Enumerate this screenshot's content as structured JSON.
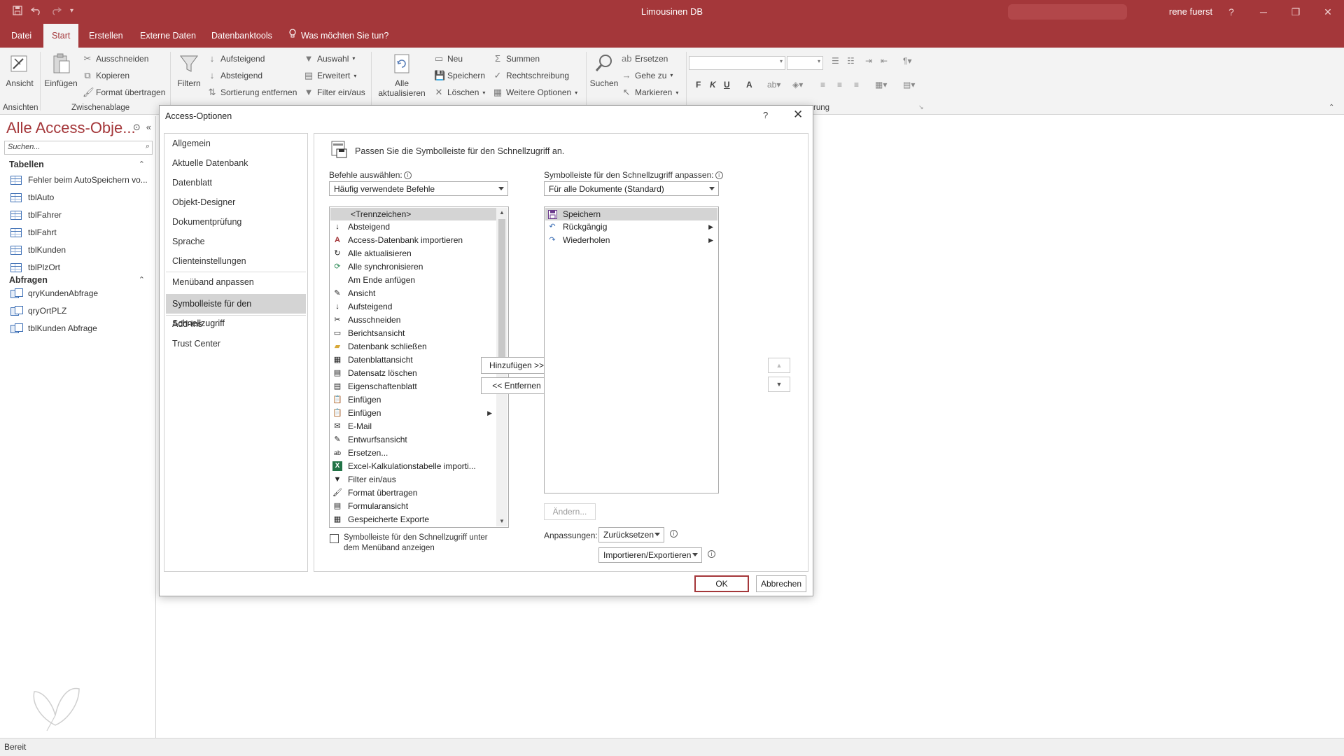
{
  "app": {
    "title": "Limousinen DB",
    "user": "rene fuerst"
  },
  "tabs": [
    "Datei",
    "Start",
    "Erstellen",
    "Externe Daten",
    "Datenbanktools"
  ],
  "tell_me": "Was möchten Sie tun?",
  "ribbon": {
    "ansicht": "Ansicht",
    "einfuegen": "Einfügen",
    "ausschneiden": "Ausschneiden",
    "kopieren": "Kopieren",
    "format_uebertragen": "Format übertragen",
    "filtern": "Filtern",
    "aufsteigend": "Aufsteigend",
    "absteigend": "Absteigend",
    "sortierung_entfernen": "Sortierung entfernen",
    "auswahl": "Auswahl",
    "erweitert": "Erweitert",
    "filter_ein_aus": "Filter ein/aus",
    "alle_aktualisieren_1": "Alle",
    "alle_aktualisieren_2": "aktualisieren",
    "neu": "Neu",
    "speichern": "Speichern",
    "loeschen": "Löschen",
    "summen": "Summen",
    "rechtschreibung": "Rechtschreibung",
    "weitere_optionen": "Weitere Optionen",
    "suchen": "Suchen",
    "ersetzen": "Ersetzen",
    "gehe_zu": "Gehe zu",
    "markieren": "Markieren",
    "fmt_bold": "F",
    "fmt_italic": "K",
    "fmt_underline": "U",
    "fmt_fontcolor": "A",
    "group_ansichten": "Ansichten",
    "group_zwischenablage": "Zwischenablage",
    "group_partial": "rung"
  },
  "nav": {
    "header": "Alle Access-Obje...",
    "search_placeholder": "Suchen...",
    "groups": [
      {
        "label": "Tabellen",
        "items": [
          "Fehler beim AutoSpeichern vo...",
          "tblAuto",
          "tblFahrer",
          "tblFahrt",
          "tblKunden",
          "tblPlzOrt"
        ]
      },
      {
        "label": "Abfragen",
        "items": [
          "qryKundenAbfrage",
          "qryOrtPLZ",
          "tblKunden Abfrage"
        ]
      }
    ]
  },
  "status": "Bereit",
  "dialog": {
    "title": "Access-Optionen",
    "help": "?",
    "close": "✕",
    "categories": [
      "Allgemein",
      "Aktuelle Datenbank",
      "Datenblatt",
      "Objekt-Designer",
      "Dokumentprüfung",
      "Sprache",
      "Clienteinstellungen",
      "Menüband anpassen",
      "Symbolleiste für den Schnellzugriff",
      "Add-Ins",
      "Trust Center"
    ],
    "selected_category": "Symbolleiste für den Schnellzugriff",
    "heading": "Passen Sie die Symbolleiste für den Schnellzugriff an.",
    "commands_label": "Befehle auswählen:",
    "commands_value": "Häufig verwendete Befehle",
    "toolbar_label": "Symbolleiste für den Schnellzugriff anpassen:",
    "toolbar_value": "Für alle Dokumente (Standard)",
    "commands": [
      {
        "label": "<Trennzeichen>",
        "icon": "separator"
      },
      {
        "label": "Absteigend",
        "icon": "sort-desc-icon"
      },
      {
        "label": "Access-Datenbank importieren",
        "icon": "access-import-icon"
      },
      {
        "label": "Alle aktualisieren",
        "icon": "refresh-all-icon"
      },
      {
        "label": "Alle synchronisieren",
        "icon": "sync-icon"
      },
      {
        "label": "Am Ende anfügen",
        "icon": ""
      },
      {
        "label": "Ansicht",
        "icon": "view-icon"
      },
      {
        "label": "Aufsteigend",
        "icon": "sort-asc-icon"
      },
      {
        "label": "Ausschneiden",
        "icon": "scissors-icon"
      },
      {
        "label": "Berichtsansicht",
        "icon": "report-view-icon"
      },
      {
        "label": "Datenbank schließen",
        "icon": "folder-icon"
      },
      {
        "label": "Datenblattansicht",
        "icon": "datasheet-icon"
      },
      {
        "label": "Datensatz löschen",
        "icon": "delete-record-icon"
      },
      {
        "label": "Eigenschaftenblatt",
        "icon": "property-sheet-icon"
      },
      {
        "label": "Einfügen",
        "icon": "paste-icon"
      },
      {
        "label": "Einfügen",
        "icon": "paste-icon",
        "submenu": true
      },
      {
        "label": "E-Mail",
        "icon": "email-icon"
      },
      {
        "label": "Entwurfsansicht",
        "icon": "design-view-icon"
      },
      {
        "label": "Ersetzen...",
        "icon": "replace-icon"
      },
      {
        "label": "Excel-Kalkulationstabelle importi...",
        "icon": "excel-icon"
      },
      {
        "label": "Filter ein/aus",
        "icon": "filter-icon"
      },
      {
        "label": "Format übertragen",
        "icon": "format-painter-icon"
      },
      {
        "label": "Formularansicht",
        "icon": "form-view-icon"
      },
      {
        "label": "Gespeicherte Exporte",
        "icon": "saved-exports-icon"
      }
    ],
    "toolbar_items": [
      {
        "label": "Speichern",
        "icon": "save-icon"
      },
      {
        "label": "Rückgängig",
        "icon": "undo-icon",
        "submenu": true
      },
      {
        "label": "Wiederholen",
        "icon": "redo-icon",
        "submenu": true
      }
    ],
    "add_button": "Hinzufügen >>",
    "remove_button": "<< Entfernen",
    "modify_button": "Ändern...",
    "customizations_label": "Anpassungen:",
    "reset_value": "Zurücksetzen",
    "import_export_value": "Importieren/Exportieren",
    "show_below_label_1": "Symbolleiste für den Schnellzugriff unter",
    "show_below_label_2": "dem Menüband anzeigen",
    "ok": "OK",
    "cancel": "Abbrechen"
  },
  "colors": {
    "accent": "#a4373a",
    "selection": "#d4d4d4",
    "ribbon_bg": "#f3f3f3"
  }
}
